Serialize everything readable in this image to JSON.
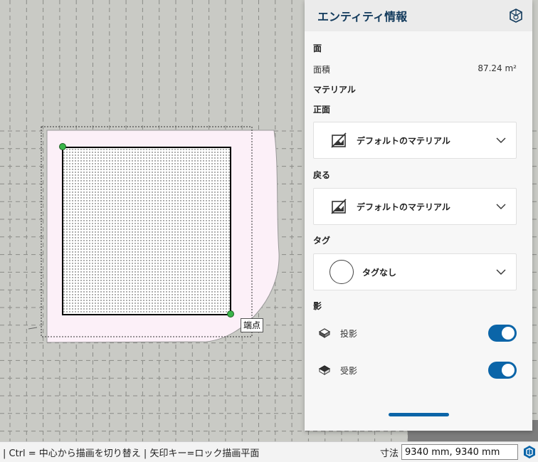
{
  "viewport": {
    "tooltip": "端点"
  },
  "panel": {
    "title": "エンティティ情報",
    "section_face": "面",
    "area_label": "面積",
    "area_value": "87.24 m²",
    "material_header": "マテリアル",
    "front_label": "正面",
    "front_material": "デフォルトのマテリアル",
    "back_label": "戻る",
    "back_material": "デフォルトのマテリアル",
    "tag_label": "タグ",
    "tag_value": "タグなし",
    "shadow_label": "影",
    "cast_label": "投影",
    "receive_label": "受影",
    "cast_enabled": true,
    "receive_enabled": true
  },
  "statusbar": {
    "hint": "| Ctrl = 中心から描画を切り替え | 矢印キー=ロック描画平面",
    "dimension_label": "寸法",
    "dimension_value": "9340 mm, 9340 mm"
  },
  "colors": {
    "accent": "#0b65a8",
    "title": "#123a5c",
    "canvas": "#c9cac5"
  },
  "icons": {
    "header": "entity-info-cube-icon",
    "material": "default-material-icon",
    "chevron": "chevron-down-icon",
    "cast": "cast-shadow-icon",
    "receive": "receive-shadow-icon",
    "logo": "sketchup-logo-icon"
  }
}
